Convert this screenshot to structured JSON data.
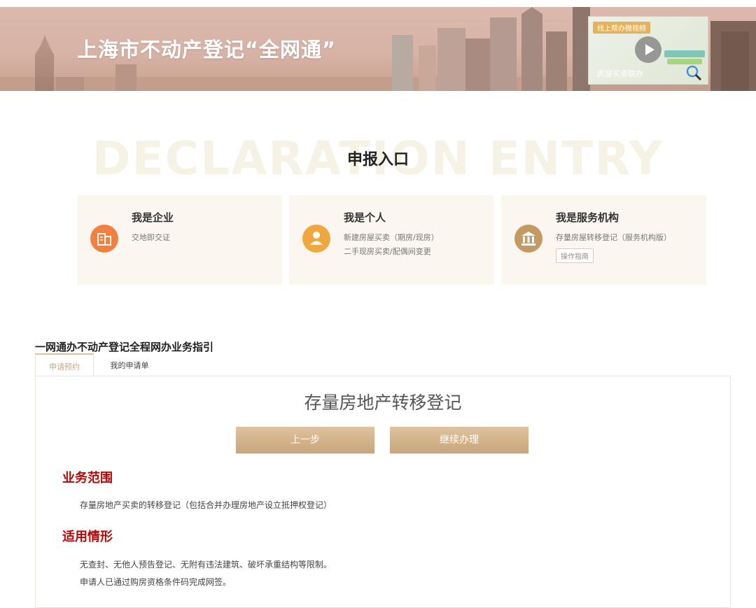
{
  "banner": {
    "title": "上海市不动产登记“全网通”",
    "video": {
      "tag": "线上帮办微视频",
      "caption": "房屋买卖联办",
      "icon": "play-icon"
    }
  },
  "declaration": {
    "watermark": "DECLARATION ENTRY",
    "title": "申报入口",
    "cards": [
      {
        "title": "我是企业",
        "lines": [
          "交地即交证"
        ],
        "icon": "building-icon",
        "icon_color": "#f3803e"
      },
      {
        "title": "我是个人",
        "lines": [
          "新建房屋买卖（期房/现房）",
          "二手现房买卖/配偶间变更"
        ],
        "icon": "person-icon",
        "icon_color": "#f0a73e"
      },
      {
        "title": "我是服务机构",
        "lines": [
          "存量房屋转移登记（服务机构版）"
        ],
        "button": "操作指南",
        "icon": "institution-icon",
        "icon_color": "#c39a62"
      }
    ]
  },
  "guide": {
    "section_title": "一网通办不动产登记全程网办业务指引",
    "tabs": [
      "申请预约",
      "我的申请单"
    ],
    "content": {
      "title": "存量房地产转移登记",
      "prev_button": "上一步",
      "next_button": "继续办理",
      "scope_heading": "业务范围",
      "scope_text": "存量房地产买卖的转移登记（包括合并办理房地产设立抵押权登记）",
      "situation_heading": "适用情形",
      "situation_lines": [
        "无查封、无他人预告登记、无附有违法建筑、破坏承重结构等限制。",
        "申请人已通过购房资格条件码完成网签。"
      ]
    }
  },
  "colors": {
    "accent_gold": "#c9a57a",
    "heading_red": "#b20a0a"
  }
}
